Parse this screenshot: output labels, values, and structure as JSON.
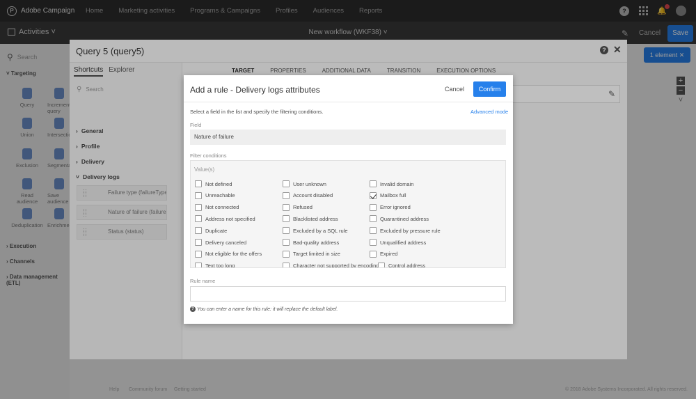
{
  "app": {
    "title": "Adobe Campaign"
  },
  "nav": [
    "Home",
    "Marketing activities",
    "Programs & Campaigns",
    "Profiles",
    "Audiences",
    "Reports"
  ],
  "workflow": {
    "activities_label": "Activities",
    "title": "New workflow (WKF38)",
    "cancel": "Cancel",
    "save": "Save",
    "selection_button": "1 element"
  },
  "palette": {
    "search_placeholder": "Search",
    "sections": [
      "Targeting",
      "Execution",
      "Channels",
      "Data management (ETL)"
    ],
    "activities": [
      "Query",
      "Incremental query",
      "Union",
      "Intersection",
      "Exclusion",
      "Segmentation",
      "Read audience",
      "Save audience",
      "Deduplication",
      "Enrichment"
    ]
  },
  "query": {
    "title": "Query 5 (query5)",
    "left_tabs": [
      "Shortcuts",
      "Explorer"
    ],
    "search_placeholder": "Search",
    "tree": [
      "General",
      "Profile",
      "Delivery",
      "Delivery logs"
    ],
    "fields": [
      "Failure type (failureType...",
      "Nature of failure (failure...",
      "Status (status)"
    ],
    "tabs": [
      "TARGET",
      "PROPERTIES",
      "ADDITIONAL DATA",
      "TRANSITION",
      "EXECUTION OPTIONS"
    ]
  },
  "dialog": {
    "title": "Add a rule - Delivery logs attributes",
    "cancel": "Cancel",
    "confirm": "Confirm",
    "instruction": "Select a field in the list and specify the filtering conditions.",
    "advanced_mode": "Advanced mode",
    "field_label": "Field",
    "field_value": "Nature of failure",
    "filter_label": "Filter conditions",
    "values_label": "Value(s)",
    "values": [
      [
        "Not defined",
        "Unreachable",
        "Not connected",
        "Address not specified",
        "Duplicate",
        "Delivery canceled",
        "Not eligible for the offers",
        "Text too long"
      ],
      [
        "User unknown",
        "Account disabled",
        "Refused",
        "Blacklisted address",
        "Excluded by a SQL rule",
        "Bad-quality address",
        "Target limited in size",
        "Character not supported by encoding"
      ],
      [
        "Invalid domain",
        "Mailbox full",
        "Error ignored",
        "Quarantined address",
        "Excluded by pressure rule",
        "Unqualified address",
        "Expired",
        "Control address"
      ]
    ],
    "checked": [
      "Mailbox full"
    ],
    "rule_name_label": "Rule name",
    "rule_name_value": "",
    "hint": "You can enter a name for this rule: it will replace the default label."
  },
  "footer": [
    "Help",
    "Community forum",
    "Getting started",
    "© 2018 Adobe Systems Incorporated. All rights reserved."
  ]
}
